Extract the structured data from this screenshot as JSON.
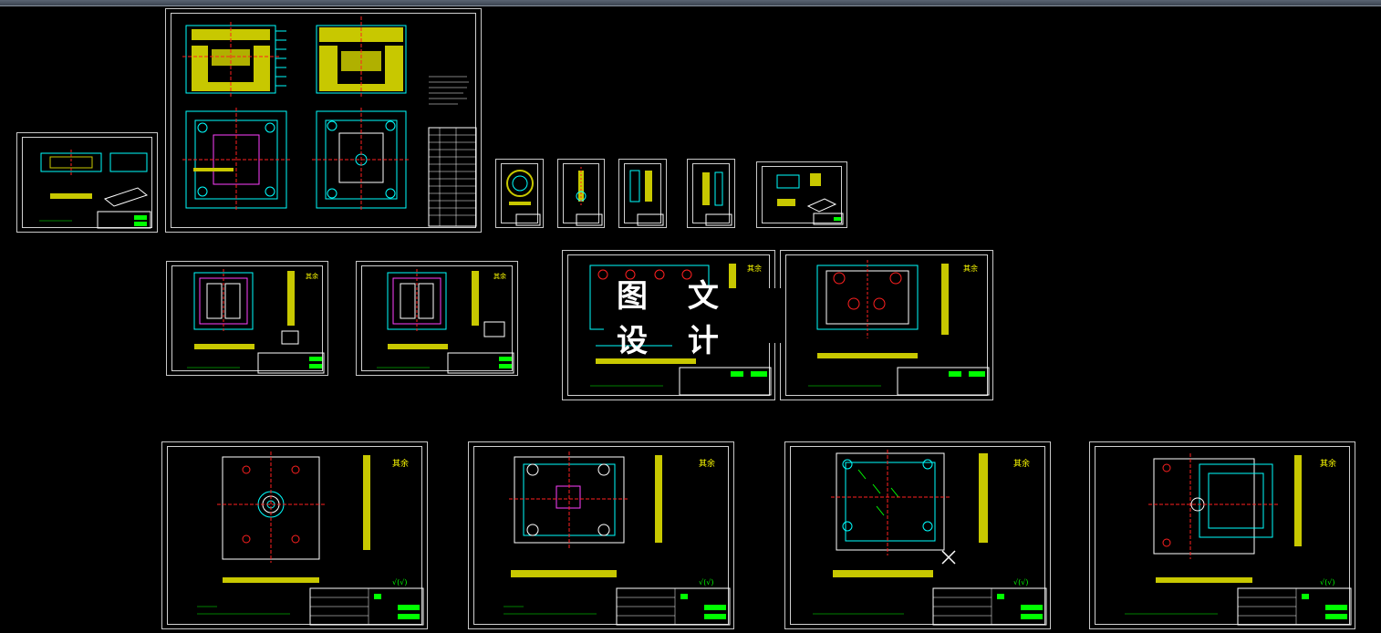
{
  "app": {
    "watermark_text": "图 文 设 计"
  },
  "sheets": [
    {
      "id": "assembly-drawing",
      "kind": "assembly"
    },
    {
      "id": "part-drawing-small-left",
      "kind": "part"
    },
    {
      "id": "detail-ring",
      "kind": "detail"
    },
    {
      "id": "detail-pin",
      "kind": "detail"
    },
    {
      "id": "detail-insert-a",
      "kind": "detail"
    },
    {
      "id": "detail-insert-b",
      "kind": "detail"
    },
    {
      "id": "detail-block",
      "kind": "detail"
    },
    {
      "id": "plate-drawing-1",
      "kind": "plate"
    },
    {
      "id": "plate-drawing-2",
      "kind": "plate"
    },
    {
      "id": "plate-drawing-3",
      "kind": "plate"
    },
    {
      "id": "plate-drawing-4",
      "kind": "plate"
    },
    {
      "id": "plate-drawing-5",
      "kind": "plate"
    },
    {
      "id": "plate-drawing-6",
      "kind": "plate"
    },
    {
      "id": "plate-drawing-7",
      "kind": "plate"
    },
    {
      "id": "plate-drawing-8",
      "kind": "plate"
    }
  ],
  "colors": {
    "background": "#000000",
    "frame": "#d0d0d0",
    "outline_cyan": "#00ffff",
    "part_yellow": "#d8d800",
    "centerline_red": "#ff2020",
    "title_green": "#00ff00",
    "dimension_magenta": "#ff40ff",
    "roughness_label": "#ffff00"
  },
  "icons": {
    "cursor": "crosshair-x-icon"
  }
}
